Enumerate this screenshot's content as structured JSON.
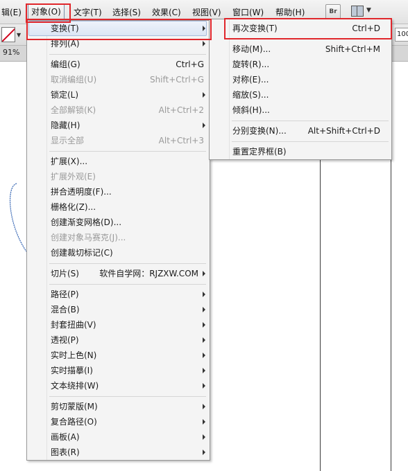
{
  "menubar": {
    "items": [
      "辑(E)",
      "对象(O)",
      "文字(T)",
      "选择(S)",
      "效果(C)",
      "视图(V)",
      "窗口(W)",
      "帮助(H)"
    ],
    "br_label": "Br",
    "zoom_label": "91%",
    "right_field": "100"
  },
  "object_menu": {
    "items": [
      {
        "label": "变换(T)",
        "shortcut": "",
        "submenu": true,
        "disabled": false
      },
      {
        "label": "排列(A)",
        "shortcut": "",
        "submenu": true,
        "disabled": false
      },
      {
        "label": "编组(G)",
        "shortcut": "Ctrl+G",
        "submenu": false,
        "disabled": false
      },
      {
        "label": "取消编组(U)",
        "shortcut": "Shift+Ctrl+G",
        "submenu": false,
        "disabled": true
      },
      {
        "label": "锁定(L)",
        "shortcut": "",
        "submenu": true,
        "disabled": false
      },
      {
        "label": "全部解锁(K)",
        "shortcut": "Alt+Ctrl+2",
        "submenu": false,
        "disabled": true
      },
      {
        "label": "隐藏(H)",
        "shortcut": "",
        "submenu": true,
        "disabled": false
      },
      {
        "label": "显示全部",
        "shortcut": "Alt+Ctrl+3",
        "submenu": false,
        "disabled": true
      },
      {
        "label": "扩展(X)...",
        "shortcut": "",
        "submenu": false,
        "disabled": false
      },
      {
        "label": "扩展外观(E)",
        "shortcut": "",
        "submenu": false,
        "disabled": true
      },
      {
        "label": "拼合透明度(F)...",
        "shortcut": "",
        "submenu": false,
        "disabled": false
      },
      {
        "label": "栅格化(Z)...",
        "shortcut": "",
        "submenu": false,
        "disabled": false
      },
      {
        "label": "创建渐变网格(D)...",
        "shortcut": "",
        "submenu": false,
        "disabled": false
      },
      {
        "label": "创建对象马赛克(J)...",
        "shortcut": "",
        "submenu": false,
        "disabled": true
      },
      {
        "label": "创建裁切标记(C)",
        "shortcut": "",
        "submenu": false,
        "disabled": false
      },
      {
        "label": "切片(S)",
        "shortcut": "软件自学网：RJZXW.COM",
        "submenu": true,
        "disabled": false
      },
      {
        "label": "路径(P)",
        "shortcut": "",
        "submenu": true,
        "disabled": false
      },
      {
        "label": "混合(B)",
        "shortcut": "",
        "submenu": true,
        "disabled": false
      },
      {
        "label": "封套扭曲(V)",
        "shortcut": "",
        "submenu": true,
        "disabled": false
      },
      {
        "label": "透视(P)",
        "shortcut": "",
        "submenu": true,
        "disabled": false
      },
      {
        "label": "实时上色(N)",
        "shortcut": "",
        "submenu": true,
        "disabled": false
      },
      {
        "label": "实时描摹(I)",
        "shortcut": "",
        "submenu": true,
        "disabled": false
      },
      {
        "label": "文本绕排(W)",
        "shortcut": "",
        "submenu": true,
        "disabled": false
      },
      {
        "label": "剪切蒙版(M)",
        "shortcut": "",
        "submenu": true,
        "disabled": false
      },
      {
        "label": "复合路径(O)",
        "shortcut": "",
        "submenu": true,
        "disabled": false
      },
      {
        "label": "画板(A)",
        "shortcut": "",
        "submenu": true,
        "disabled": false
      },
      {
        "label": "图表(R)",
        "shortcut": "",
        "submenu": true,
        "disabled": false
      }
    ]
  },
  "transform_submenu": {
    "items": [
      {
        "label": "再次变换(T)",
        "shortcut": "Ctrl+D"
      },
      {
        "label": "移动(M)...",
        "shortcut": "Shift+Ctrl+M"
      },
      {
        "label": "旋转(R)...",
        "shortcut": ""
      },
      {
        "label": "对称(E)...",
        "shortcut": ""
      },
      {
        "label": "缩放(S)...",
        "shortcut": ""
      },
      {
        "label": "倾斜(H)...",
        "shortcut": ""
      },
      {
        "label": "分别变换(N)...",
        "shortcut": "Alt+Shift+Ctrl+D"
      },
      {
        "label": "重置定界框(B)",
        "shortcut": ""
      }
    ]
  },
  "colors": {
    "highlight_border": "#e0262b",
    "menu_bg": "#f4f4f4",
    "disabled_text": "#9a9a9a",
    "path_stroke": "#2d5fb0"
  }
}
